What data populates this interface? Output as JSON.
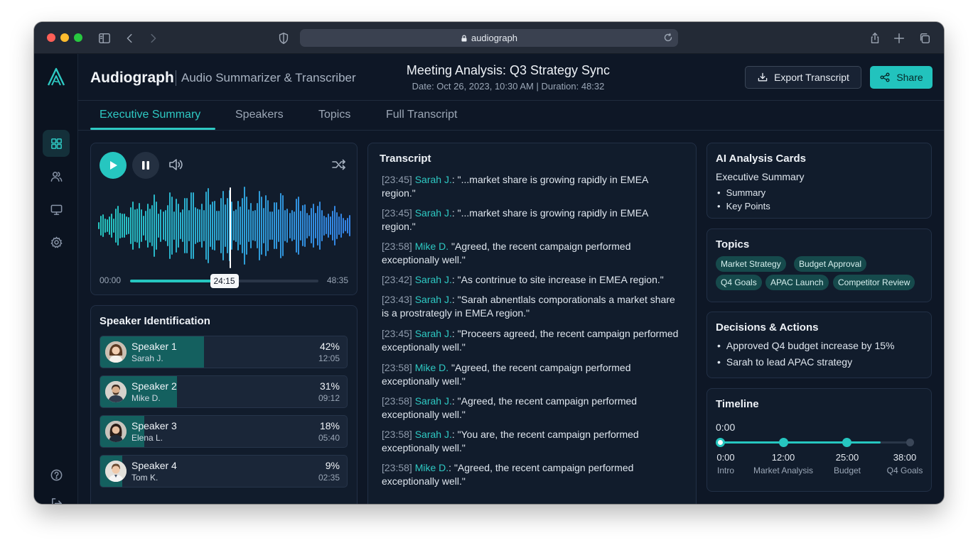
{
  "browser": {
    "url": "audiograph"
  },
  "app": {
    "name": "Audiograph",
    "subtitle": "Audio Summarizer & Transcriber"
  },
  "meeting": {
    "title": "Meeting Analysis: Q3 Strategy Sync",
    "meta": "Date: Oct 26, 2023, 10:30 AM | Duration: 48:32"
  },
  "actions": {
    "export_label": "Export Transcript",
    "share_label": "Share"
  },
  "tabs": [
    {
      "label": "Executive Summary",
      "active": true
    },
    {
      "label": "Speakers",
      "active": false
    },
    {
      "label": "Topics",
      "active": false
    },
    {
      "label": "Full Transcript",
      "active": false
    }
  ],
  "player": {
    "time_start": "00:00",
    "time_current": "24:15",
    "time_end": "48:35",
    "progress": 0.5
  },
  "speakers": {
    "title": "Speaker Identification",
    "items": [
      {
        "name": "Speaker 1",
        "person": "Sarah J.",
        "percent": "42%",
        "share": 0.42,
        "duration": "12:05"
      },
      {
        "name": "Speaker 2",
        "person": "Mike D.",
        "percent": "31%",
        "share": 0.31,
        "duration": "09:12"
      },
      {
        "name": "Speaker 3",
        "person": "Elena L.",
        "percent": "18%",
        "share": 0.18,
        "duration": "05:40"
      },
      {
        "name": "Speaker 4",
        "person": "Tom K.",
        "percent": "9%",
        "share": 0.09,
        "duration": "02:35"
      }
    ]
  },
  "transcript": {
    "title": "Transcript",
    "lines": [
      {
        "time": "[23:45]",
        "speaker": "Sarah J.",
        "sep": ":",
        "text": " \"...market share is growing rapidly in EMEA region.\""
      },
      {
        "time": "[23:45]",
        "speaker": "Sarah J.",
        "sep": ":",
        "text": " \"...market share is growing rapidly in EMEA region.\""
      },
      {
        "time": "[23:58]",
        "speaker": "Mike D.",
        "sep": "",
        "text": " \"Agreed, the recent campaign performed exceptionally well.\""
      },
      {
        "time": "[23:42]",
        "speaker": "Sarah J.",
        "sep": ":",
        "text": " \"As contrinue to site increase in EMEA region.\""
      },
      {
        "time": "[23:43]",
        "speaker": "Sarah J.",
        "sep": ":",
        "text": " \"Sarah abnentlals comporationals a market share is a prostrategly in EMEA region.\""
      },
      {
        "time": "[23:45]",
        "speaker": "Sarah J.",
        "sep": ":",
        "text": " \"Proceers agreed, the recent campaign performed exceptionally well.\""
      },
      {
        "time": "[23:58]",
        "speaker": "Mike D.",
        "sep": "",
        "text": " \"Agreed, the recent campaign performed exceptionally well.\""
      },
      {
        "time": "[23:58]",
        "speaker": "Sarah J.",
        "sep": ":",
        "text": " \"Agreed, the recent campaign performed exceptionally well.\""
      },
      {
        "time": "[23:58]",
        "speaker": "Sarah J.",
        "sep": ":",
        "text": " \"You are, the recent campaign performed exceptionally well.\""
      },
      {
        "time": "[23:58]",
        "speaker": "Mike D.",
        "sep": ":",
        "text": " \"Agreed, the recent campaign performed exceptionally well.\""
      }
    ]
  },
  "ai_cards": {
    "title": "AI Analysis Cards",
    "subtitle": "Executive Summary",
    "bullets": [
      "Summary",
      "Key Points"
    ]
  },
  "topics": {
    "title": "Topics",
    "chips": [
      "Market Strategy",
      "Budget Approval",
      "Q4 Goals",
      "APAC Launch",
      "Competitor Review"
    ]
  },
  "decisions": {
    "title": "Decisions & Actions",
    "items": [
      "Approved Q4 budget increase by 15%",
      "Sarah to lead APAC strategy"
    ]
  },
  "timeline": {
    "title": "Timeline",
    "current": "0:00",
    "progress": 0.84,
    "points": [
      {
        "time": "0:00",
        "label": "Intro"
      },
      {
        "time": "12:00",
        "label": "Market Analysis"
      },
      {
        "time": "25:00",
        "label": "Budget"
      },
      {
        "time": "38:00",
        "label": "Q4 Goals"
      }
    ]
  },
  "colors": {
    "accent": "#26c6c0",
    "background": "#0e1726",
    "card": "#111c2c"
  },
  "icons": {
    "rail": [
      "dashboard-icon",
      "users-icon",
      "monitor-icon",
      "settings-icon",
      "help-icon",
      "logout-icon"
    ],
    "player": [
      "play-icon",
      "pause-icon",
      "volume-icon",
      "shuffle-icon"
    ]
  }
}
